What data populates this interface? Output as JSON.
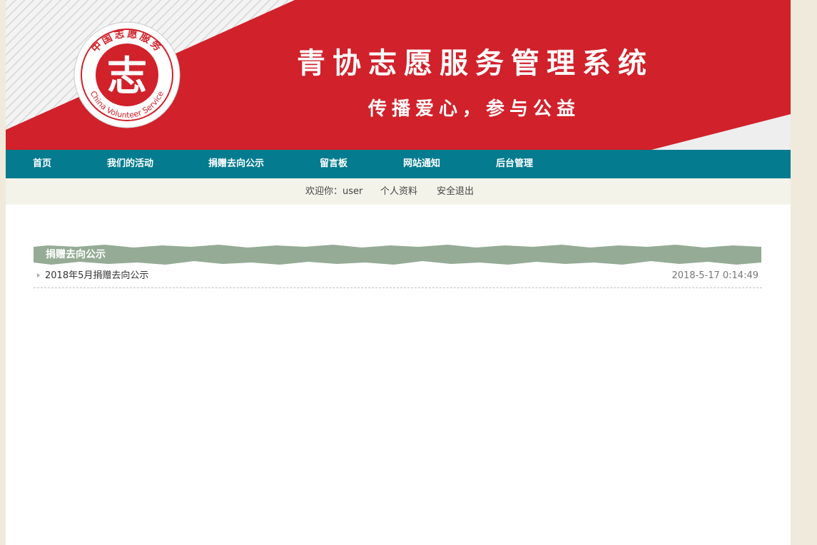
{
  "header": {
    "title": "青协志愿服务管理系统",
    "slogan": "传播爱心，参与公益",
    "logo": {
      "top_text": "中国志愿服务",
      "center_char": "志",
      "bottom_text": "China Volunteer Service"
    }
  },
  "nav": {
    "items": [
      {
        "label": "首页"
      },
      {
        "label": "我们的活动"
      },
      {
        "label": "捐赠去向公示"
      },
      {
        "label": "留言板"
      },
      {
        "label": "网站通知"
      },
      {
        "label": "后台管理"
      }
    ]
  },
  "userbar": {
    "welcome": "欢迎你：user",
    "profile": "个人资料",
    "logout": "安全退出"
  },
  "section": {
    "title": "捐赠去向公示",
    "rows": [
      {
        "title": "2018年5月捐赠去向公示",
        "date": "2018-5-17 0:14:49"
      }
    ]
  },
  "colors": {
    "banner_red": "#d1212b",
    "nav_teal": "#047b8e",
    "section_header": "#95ab95"
  }
}
